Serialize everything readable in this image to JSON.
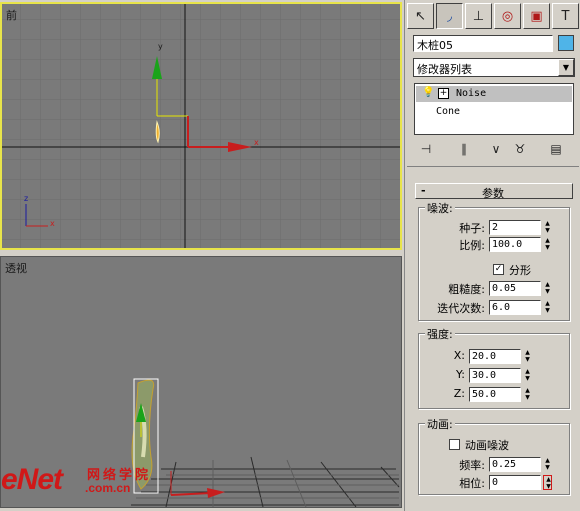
{
  "viewports": {
    "front": {
      "label": "前",
      "axis_y": "y",
      "axis_x": "x",
      "corner_z": "z",
      "corner_x": "x"
    },
    "perspective": {
      "label": "透视"
    }
  },
  "watermark": {
    "brand": "eNet",
    "cn": "网络学院",
    "domain": ".com.cn"
  },
  "command_panel": {
    "tabs": [
      "create-icon",
      "modify-icon",
      "hierarchy-icon",
      "motion-icon",
      "display-icon",
      "utilities-icon"
    ],
    "object_name": "木桩05",
    "object_color": "#4fb4e8",
    "modifier_list": "修改器列表",
    "stack": [
      {
        "label": "Noise",
        "selected": true,
        "expand": "+"
      },
      {
        "label": "Cone",
        "selected": false
      }
    ],
    "rollout_title": "参数",
    "rollout_sign": "-",
    "noise_group": {
      "title": "噪波:",
      "seed_label": "种子:",
      "seed": "2",
      "scale_label": "比例:",
      "scale": "100.0",
      "fractal_label": "分形",
      "fractal_checked": "✓",
      "roughness_label": "粗糙度:",
      "roughness": "0.05",
      "iterations_label": "迭代次数:",
      "iterations": "6.0"
    },
    "strength_group": {
      "title": "强度:",
      "x_label": "X:",
      "x": "20.0",
      "y_label": "Y:",
      "y": "30.0",
      "z_label": "Z:",
      "z": "50.0"
    },
    "animation_group": {
      "title": "动画:",
      "animate_label": "动画噪波",
      "frequency_label": "频率:",
      "frequency": "0.25",
      "phase_label": "相位:",
      "phase": "0"
    }
  }
}
